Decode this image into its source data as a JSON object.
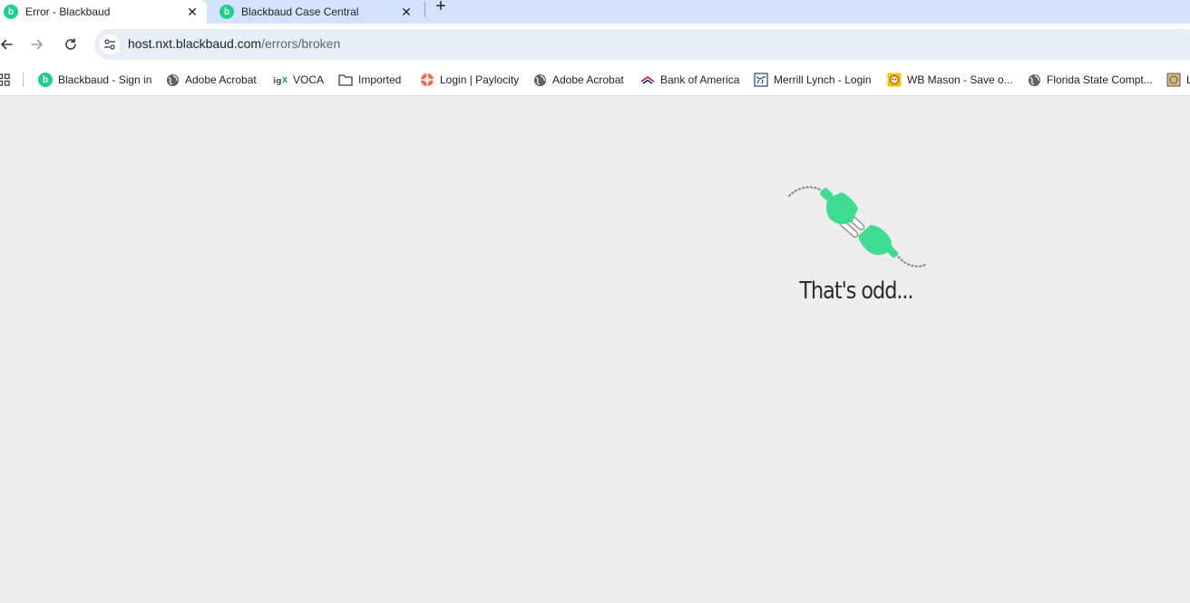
{
  "tabs": [
    {
      "title": "Error - Blackbaud",
      "favicon": "blackbaud-logo",
      "active": true
    },
    {
      "title": "Blackbaud Case Central",
      "favicon": "blackbaud-logo",
      "active": false
    }
  ],
  "favicon_glyph": "b",
  "new_tab_glyph": "+",
  "close_glyph": "✕",
  "address_bar": {
    "host": "host.nxt.blackbaud.com",
    "path": "/errors/broken"
  },
  "bookmarks": [
    {
      "label": "Blackbaud - Sign in",
      "icon": "blackbaud-logo"
    },
    {
      "label": "Adobe Acrobat",
      "icon": "globe-icon"
    },
    {
      "label": "VOCA",
      "icon": "igx-logo"
    },
    {
      "label": "Imported",
      "icon": "folder-icon"
    },
    {
      "label": "Login | Paylocity",
      "icon": "paylocity-logo"
    },
    {
      "label": "Adobe Acrobat",
      "icon": "globe-icon"
    },
    {
      "label": "Bank of America",
      "icon": "bank-of-america-logo"
    },
    {
      "label": "Merrill Lynch - Login",
      "icon": "merrill-bull-logo"
    },
    {
      "label": "WB Mason - Save o...",
      "icon": "wb-mason-logo"
    },
    {
      "label": "Florida State Compt...",
      "icon": "globe-icon"
    }
  ],
  "bookmark_overflow_glyph": "L",
  "error_page": {
    "message": "That's odd...",
    "illustration": "unplugged-cord-icon"
  },
  "colors": {
    "tab_strip": "#d3e3fd",
    "accent_green": "#3ddc8f",
    "content_bg": "#ededed"
  }
}
